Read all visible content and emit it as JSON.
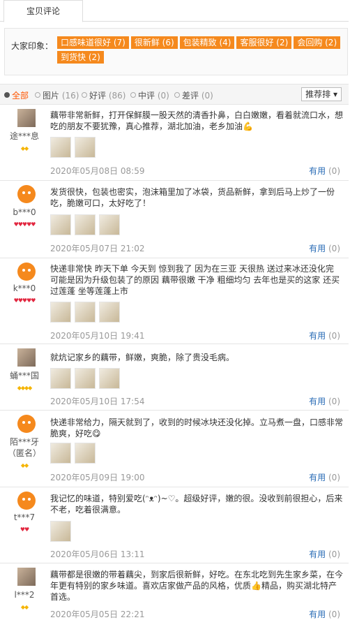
{
  "tab": {
    "label": "宝贝评论"
  },
  "impression": {
    "label": "大家印象：",
    "tags": [
      "口感味道很好 (7)",
      "很新鲜 (6)",
      "包装精致 (4)",
      "客服很好 (2)",
      "会回购 (2)",
      "到货快 (2)"
    ]
  },
  "filters": {
    "all": "全部",
    "pics": {
      "label": "图片",
      "count": "(16)"
    },
    "good": {
      "label": "好评",
      "count": "(86)"
    },
    "mid": {
      "label": "中评",
      "count": "(0)"
    },
    "bad": {
      "label": "差评",
      "count": "(0)"
    },
    "sort_label": "推荐排 ▾"
  },
  "reviews": [
    {
      "user": "途***息",
      "level_icons": "◆◆",
      "level_color": "#f5b400",
      "text": "藕带非常新鲜，打开保鲜膜一股天然的清香扑鼻，白白嫩嫩，看着就流口水，想吃的朋友不要犹豫，真心推荐，湖北加油，老乡加油💪",
      "date": "2020年05月08日 08:59",
      "useful": "有用",
      "useful_count": "(0)"
    },
    {
      "user": "b***0",
      "level_icons": "♥♥♥♥♥",
      "level_color": "#e2263f",
      "text": "发货很快，包装也密实，泡沫箱里加了冰袋，货品新鲜，拿到后马上炒了一份吃，脆嫩可口，太好吃了！",
      "date": "2020年05月07日 21:02",
      "useful": "有用",
      "useful_count": "(0)"
    },
    {
      "user": "k***0",
      "level_icons": "♥♥♥♥♥",
      "level_color": "#e2263f",
      "text": "快递非常快 昨天下单 今天到 惊到我了 因为在三亚 天很热 送过来冰还没化完 可能是因为升级包装了的原因 藕带很嫩 干净 粗细均匀 去年也是买的这家 还买过莲蓬 坐等莲蓬上市",
      "date": "2020年05月10日 19:41",
      "useful": "有用",
      "useful_count": "(0)"
    },
    {
      "user": "蛹***国",
      "level_icons": "◆◆◆◆",
      "level_color": "#f5b400",
      "text": "就炕记家乡的藕带，鲜嫩，爽脆，除了贵没毛病。",
      "date": "2020年05月10日 17:54",
      "useful": "有用",
      "useful_count": "(0)"
    },
    {
      "user": "陌***牙",
      "user2": "（匿名）",
      "level_icons": "◆◆",
      "level_color": "#f5b400",
      "text": "快递非常给力，隔天就到了，收到的时候冰块还没化掉。立马煮一盘，口感非常脆爽，好吃😋",
      "date": "2020年05月09日 19:00",
      "useful": "有用",
      "useful_count": "(0)"
    },
    {
      "user": "t***7",
      "level_icons": "♥♥",
      "level_color": "#e2263f",
      "text": "我记忆的味道，特别爱吃(ᵔᴥᵔ)~♡。超级好评，嫩的很。没收到前很担心，后来不老，吃着很满意。",
      "date": "2020年05月06日 13:11",
      "useful": "有用",
      "useful_count": "(0)"
    },
    {
      "user": "l***2",
      "level_icons": "◆◆",
      "level_color": "#f5b400",
      "text": "藕带都是很嫩的带着藕尖，到家后很新鲜，好吃。在东北吃到先生家乡菜，在今年更有特别的家乡味道。喜欢店家做产品的风格，优质👍精品，购买湖北特产首选。",
      "date": "2020年05月05日 22:21",
      "useful": "有用",
      "useful_count": "(0)"
    }
  ]
}
